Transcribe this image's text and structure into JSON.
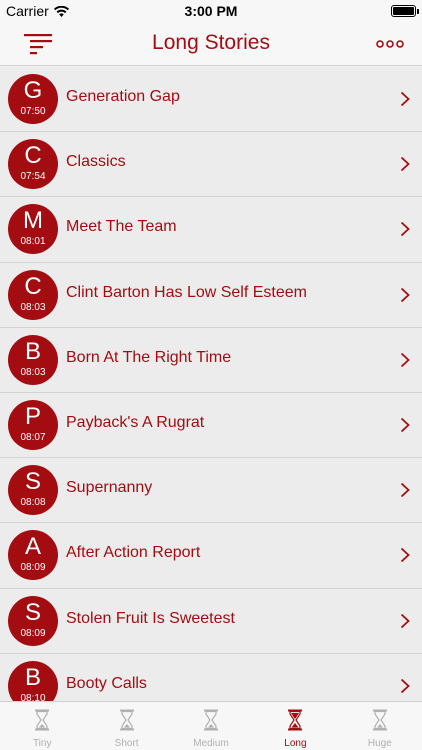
{
  "status_bar": {
    "carrier": "Carrier",
    "time": "3:00 PM"
  },
  "nav": {
    "title": "Long Stories"
  },
  "colors": {
    "accent": "#a30d12",
    "inactive": "#b0b0b0",
    "background": "#ececec"
  },
  "stories": [
    {
      "letter": "G",
      "time": "07:50",
      "title": "Generation Gap"
    },
    {
      "letter": "C",
      "time": "07:54",
      "title": "Classics"
    },
    {
      "letter": "M",
      "time": "08:01",
      "title": "Meet The Team"
    },
    {
      "letter": "C",
      "time": "08:03",
      "title": "Clint Barton Has Low Self Esteem"
    },
    {
      "letter": "B",
      "time": "08:03",
      "title": "Born At The Right Time"
    },
    {
      "letter": "P",
      "time": "08:07",
      "title": "Payback's A Rugrat"
    },
    {
      "letter": "S",
      "time": "08:08",
      "title": "Supernanny"
    },
    {
      "letter": "A",
      "time": "08:09",
      "title": "After Action Report"
    },
    {
      "letter": "S",
      "time": "08:09",
      "title": "Stolen Fruit Is Sweetest"
    },
    {
      "letter": "B",
      "time": "08:10",
      "title": "Booty Calls"
    }
  ],
  "tabs": [
    {
      "label": "Tiny",
      "icon": "hourglass-icon",
      "active": false
    },
    {
      "label": "Short",
      "icon": "hourglass-icon",
      "active": false
    },
    {
      "label": "Medium",
      "icon": "hourglass-icon",
      "active": false
    },
    {
      "label": "Long",
      "icon": "hourglass-icon",
      "active": true
    },
    {
      "label": "Huge",
      "icon": "hourglass-icon",
      "active": false
    }
  ]
}
